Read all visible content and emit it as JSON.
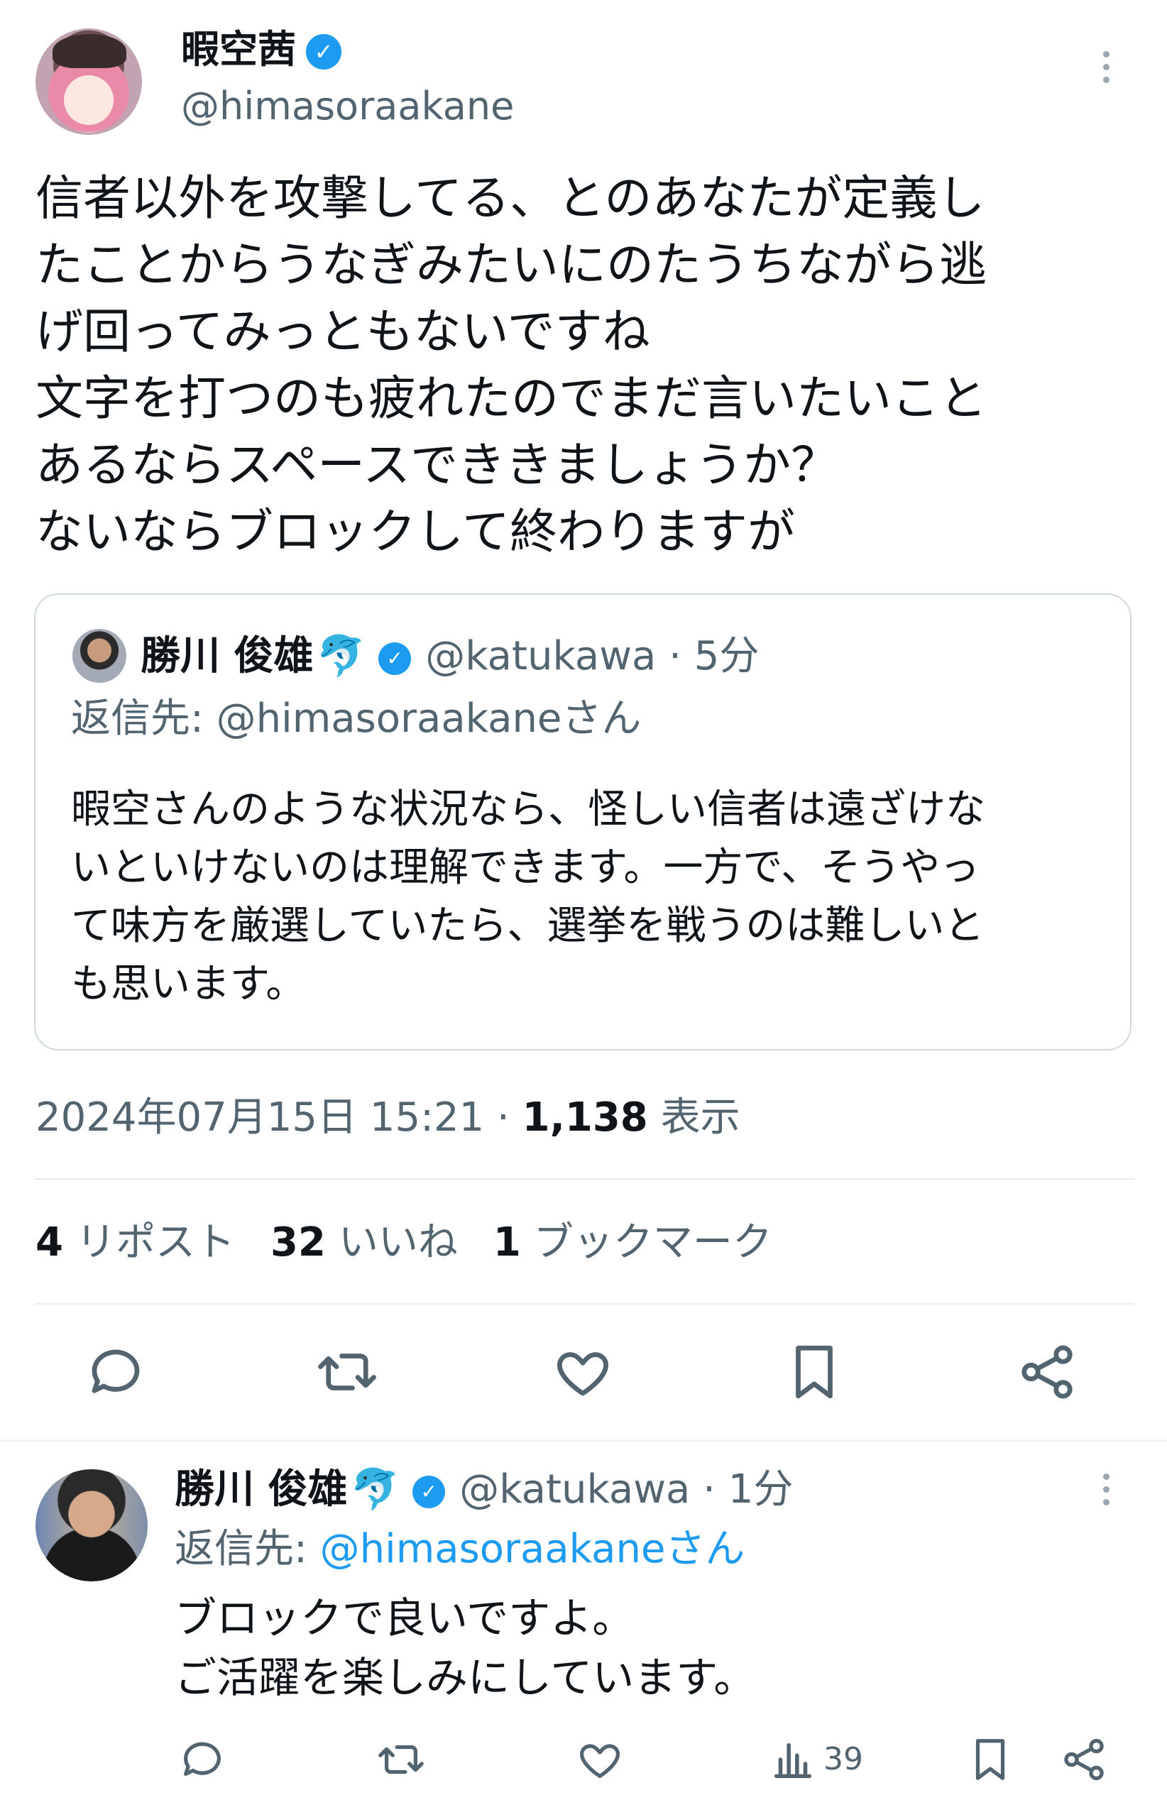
{
  "tweet": {
    "display_name": "暇空茜",
    "handle": "@himasoraakane",
    "text": "信者以外を攻撃してる、とのあなたが定義し\nたことからうなぎみたいにのたうちながら逃\nげ回ってみっともないですね\n文字を打つのも疲れたのでまだ言いたいこと\nあるならスペースでききましょうか？\nないならブロックして終わりますが",
    "quote": {
      "display_name": "勝川 俊雄",
      "emoji": "🐬",
      "handle_time": "@katukawa · 5分",
      "reply_to": "返信先: @himasoraakaneさん",
      "text": "暇空さんのような状況なら、怪しい信者は遠ざけな\nいといけないのは理解できます。一方で、そうやっ\nて味方を厳選していたら、選挙を戦うのは難しいと\nも思います。"
    },
    "timestamp": "2024年07月15日 15:21 · ",
    "views_count": "1,138",
    "views_label": " 表示",
    "stats": {
      "reposts_count": "4",
      "reposts_label": "リポスト",
      "likes_count": "32",
      "likes_label": "いいね",
      "bookmarks_count": "1",
      "bookmarks_label": "ブックマーク"
    }
  },
  "reply": {
    "display_name": "勝川 俊雄",
    "emoji": "🐬",
    "handle_time": "@katukawa · 1分",
    "reply_prefix": "返信先: ",
    "reply_mention": "@himasoraakaneさん",
    "text": "ブロックで良いですよ。\nご活躍を楽しみにしています。",
    "views": "39"
  },
  "icons": {
    "reply": "speech-bubble-icon",
    "repost": "repost-arrows-icon",
    "like": "heart-icon",
    "bookmark": "bookmark-icon",
    "share": "share-icon",
    "views": "bar-chart-icon",
    "more": "more-vertical-icon",
    "verified": "verified-badge-icon"
  },
  "colors": {
    "accent": "#1d9bf0",
    "text": "#0f1419",
    "secondary": "#536471",
    "border": "#cfd9de"
  }
}
